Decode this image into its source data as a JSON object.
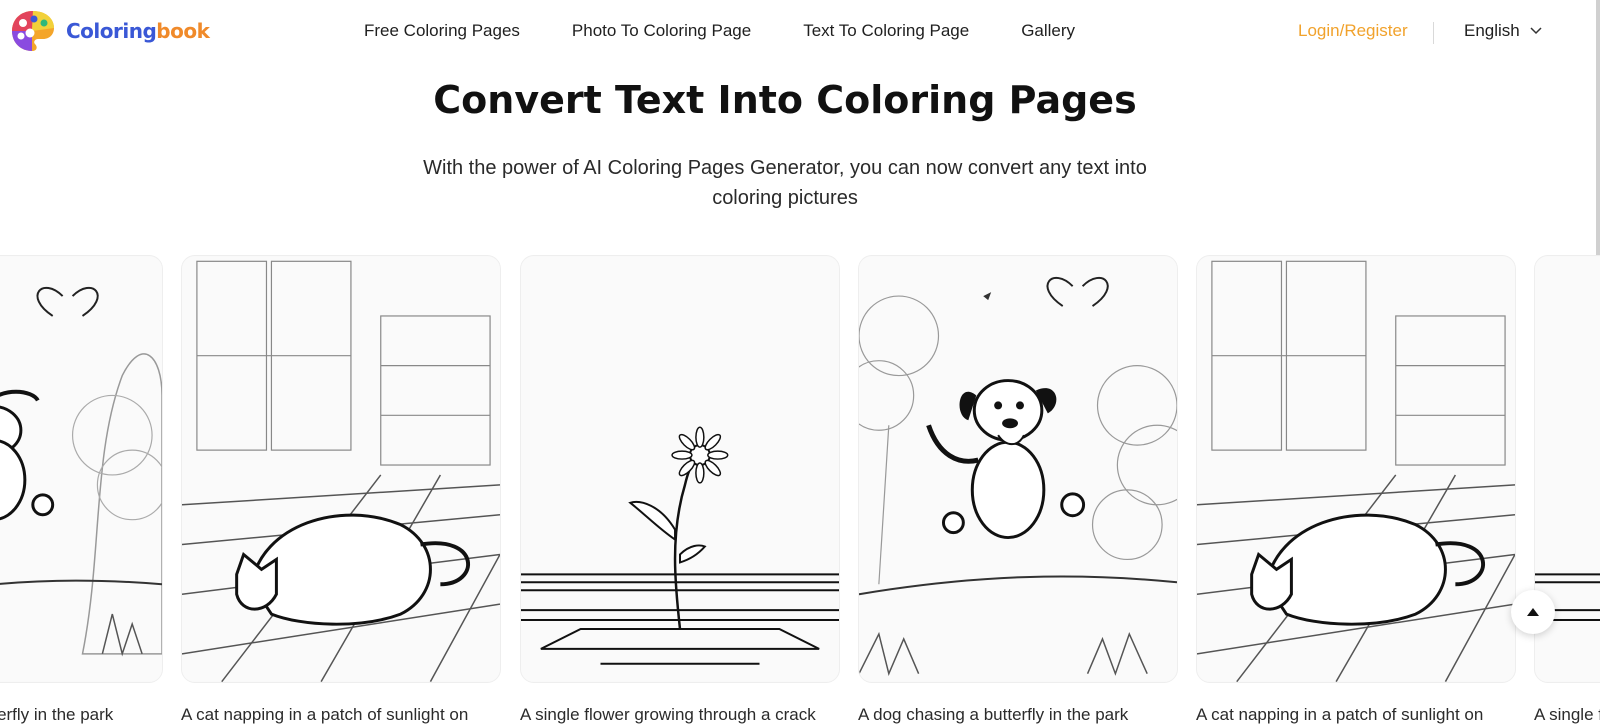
{
  "brand": {
    "word1": "Coloring",
    "word2": "book",
    "accent_blue": "#3a58d6",
    "accent_orange": "#f08a2a"
  },
  "nav": {
    "items": [
      {
        "label": "Free Coloring Pages"
      },
      {
        "label": "Photo To Coloring Page"
      },
      {
        "label": "Text To Coloring Page"
      },
      {
        "label": "Gallery"
      }
    ],
    "login_label": "Login/Register",
    "login_color": "#f1a22c",
    "language": "English",
    "language_icon": "chevron-down-icon"
  },
  "hero": {
    "title": "Convert Text Into Coloring Pages",
    "subtitle": "With the power of AI Coloring Pages Generator, you can now convert any text into coloring pictures"
  },
  "gallery": {
    "cards": [
      {
        "caption": "A dog chasing a butterfly in the park",
        "image": "dog-butterfly"
      },
      {
        "caption": "A cat napping in a patch of sunlight on",
        "image": "cat-napping"
      },
      {
        "caption": "A single flower growing through a crack",
        "image": "flower-crack"
      },
      {
        "caption": "A dog chasing a butterfly in the park",
        "image": "dog-butterfly"
      },
      {
        "caption": "A cat napping in a patch of sunlight on",
        "image": "cat-napping"
      },
      {
        "caption": "A single flower growing through a crack",
        "image": "flower-crack"
      }
    ]
  },
  "back_to_top_icon": "arrow-up-icon"
}
